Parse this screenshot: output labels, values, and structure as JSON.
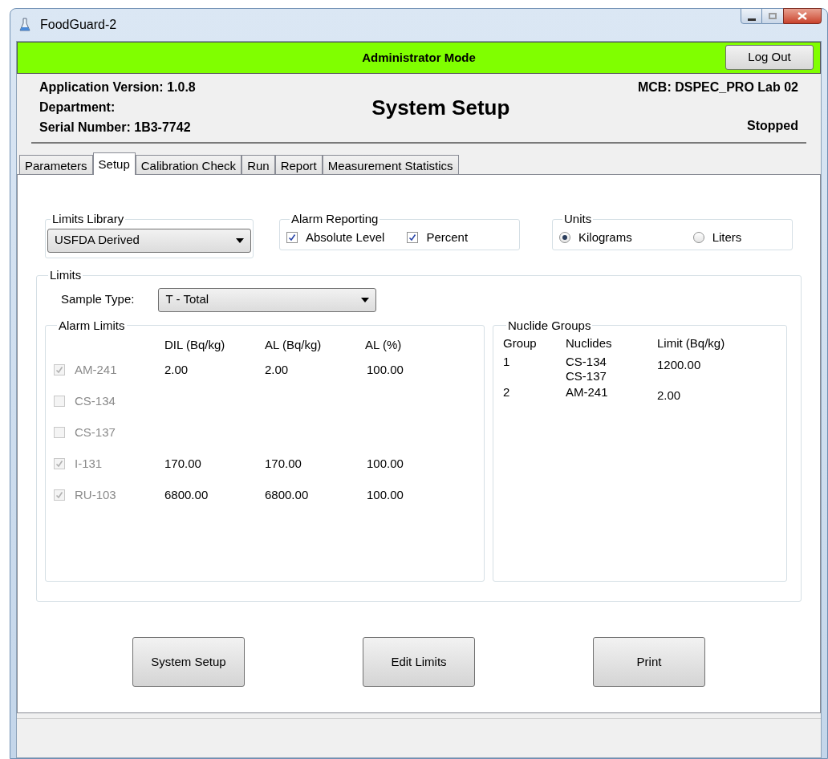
{
  "window": {
    "title": "FoodGuard-2"
  },
  "mode_bar": {
    "text": "Administrator Mode",
    "button": "Log Out"
  },
  "header": {
    "info": [
      "Application Version: 1.0.8",
      "Department:",
      "Serial Number: 1B3-7742"
    ],
    "title": "System Setup",
    "mcb": "MCB: DSPEC_PRO Lab 02",
    "status": "Stopped"
  },
  "tabs": [
    {
      "label": "Parameters",
      "selected": false
    },
    {
      "label": "Setup",
      "selected": true
    },
    {
      "label": "Calibration Check",
      "selected": false
    },
    {
      "label": "Run",
      "selected": false
    },
    {
      "label": "Report",
      "selected": false
    },
    {
      "label": "Measurement Statistics",
      "selected": false
    }
  ],
  "limits_library": {
    "label": "Limits Library",
    "value": "USFDA Derived"
  },
  "alarm_reporting": {
    "label": "Alarm Reporting",
    "options": [
      {
        "label": "Absolute Level",
        "checked": true
      },
      {
        "label": "Percent",
        "checked": true
      }
    ]
  },
  "units": {
    "label": "Units",
    "options": [
      {
        "label": "Kilograms",
        "selected": true
      },
      {
        "label": "Liters",
        "selected": false
      }
    ]
  },
  "limits": {
    "label": "Limits",
    "sample_type_label": "Sample Type:",
    "sample_type": "T - Total",
    "alarm_limits": {
      "label": "Alarm Limits",
      "columns": [
        "DIL (Bq/kg)",
        "AL (Bq/kg)",
        "AL (%)"
      ],
      "rows": [
        {
          "nuclide": "AM-241",
          "checked": true,
          "values": [
            "2.00",
            "2.00",
            "100.00"
          ]
        },
        {
          "nuclide": "CS-134",
          "checked": false,
          "values": []
        },
        {
          "nuclide": "CS-137",
          "checked": false,
          "values": []
        },
        {
          "nuclide": "I-131",
          "checked": true,
          "values": [
            "170.00",
            "170.00",
            "100.00"
          ]
        },
        {
          "nuclide": "RU-103",
          "checked": true,
          "values": [
            "6800.00",
            "6800.00",
            "100.00"
          ]
        }
      ]
    },
    "nuclide_groups": {
      "label": "Nuclide Groups",
      "columns": [
        "Group",
        "Nuclides",
        "Limit (Bq/kg)"
      ],
      "rows": [
        {
          "group": "1",
          "nuclides": [
            "CS-134",
            "CS-137"
          ],
          "limit": "1200.00"
        },
        {
          "group": "2",
          "nuclides": [
            "AM-241"
          ],
          "limit": "2.00"
        }
      ]
    }
  },
  "buttons": [
    "System Setup",
    "Edit Limits",
    "Print"
  ]
}
